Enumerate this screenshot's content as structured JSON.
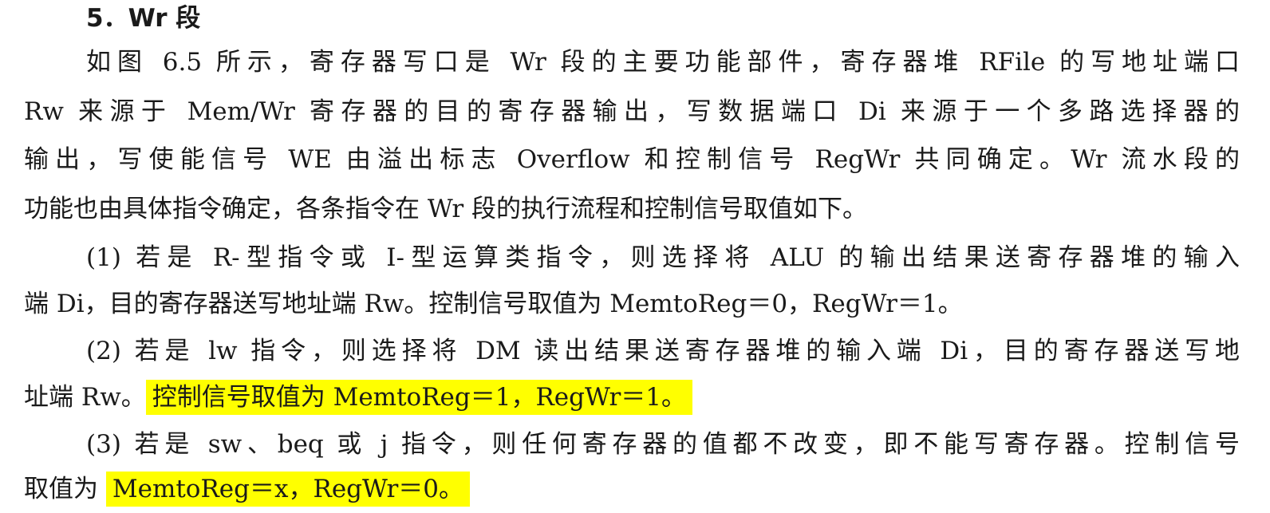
{
  "heading": "5．Wr 段",
  "lines": [
    "如图 6.5 所示，寄存器写口是 Wr 段的主要功能部件，寄存器堆 RFile 的写地址端口",
    "Rw 来源于 Mem/Wr 寄存器的目的寄存器输出，写数据端口 Di 来源于一个多路选择器的",
    "输出，写使能信号 WE 由溢出标志 Overflow 和控制信号 RegWr 共同确定。Wr 流水段的",
    "功能也由具体指令确定，各条指令在 Wr 段的执行流程和控制信号取值如下。",
    "(1) 若是 R-型指令或 I-型运算类指令，则选择将 ALU 的输出结果送寄存器堆的输入",
    "端 Di，目的寄存器送写地址端 Rw。控制信号取值为 MemtoReg＝0，RegWr＝1。",
    "(2) 若是 lw 指令，则选择将 DM 读出结果送寄存器堆的输入端 Di，目的寄存器送写地",
    "(3) 若是 sw、beq 或 j 指令，则任何寄存器的值都不改变，即不能写寄存器。控制信号"
  ],
  "line_lw_2": {
    "plain": "址端 Rw。",
    "highlight": "控制信号取值为 MemtoReg＝1，RegWr＝1。"
  },
  "line_sw_2": {
    "plain": "取值为 ",
    "highlight": "MemtoReg＝x，RegWr＝0。"
  },
  "colors": {
    "text": "#1a1a1a",
    "highlight": "#ffff00",
    "background": "#ffffff"
  }
}
